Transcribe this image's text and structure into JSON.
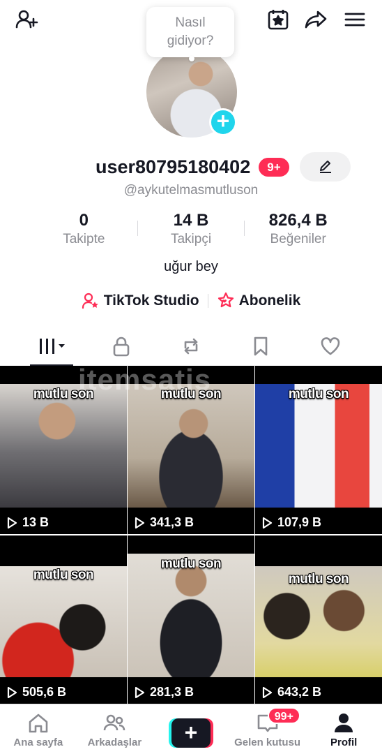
{
  "top_bar": {
    "add_friend_icon": "add-user-icon",
    "calendar_icon": "calendar-star-icon",
    "share_icon": "share-arrow-icon",
    "menu_icon": "hamburger-icon"
  },
  "bubble": {
    "line1": "Nasıl",
    "line2": "gidiyor?"
  },
  "profile": {
    "username": "user80795180402",
    "notification_badge": "9+",
    "handle": "@aykutelmasmutluson",
    "bio": "uğur bey"
  },
  "stats": [
    {
      "value": "0",
      "label": "Takipte"
    },
    {
      "value": "14 B",
      "label": "Takipçi"
    },
    {
      "value": "826,4 B",
      "label": "Beğeniler"
    }
  ],
  "links": [
    {
      "label": "TikTok Studio",
      "icon": "person-star-icon"
    },
    {
      "label": "Abonelik",
      "icon": "star-heart-icon"
    }
  ],
  "tabs": [
    "videos-grid-icon",
    "lock-icon",
    "repost-icon",
    "bookmark-icon",
    "heart-icon"
  ],
  "watermark": "itemsatis",
  "videos": [
    {
      "caption": "mutlu son",
      "views": "13 B"
    },
    {
      "caption": "mutlu son",
      "views": "341,3 B"
    },
    {
      "caption": "mutlu son",
      "views": "107,9 B"
    },
    {
      "caption": "mutlu son",
      "views": "505,6 B"
    },
    {
      "caption": "mutlu son",
      "views": "281,3 B"
    },
    {
      "caption": "mutlu son",
      "views": "643,2 B"
    }
  ],
  "bottom_nav": [
    {
      "label": "Ana sayfa"
    },
    {
      "label": "Arkadaşlar"
    },
    {
      "label": "+"
    },
    {
      "label": "Gelen kutusu",
      "badge": "99+"
    },
    {
      "label": "Profil"
    }
  ],
  "colors": {
    "accent": "#fe2c55",
    "cyan": "#20d5ec",
    "text": "#161823",
    "muted": "#8a8b91"
  }
}
